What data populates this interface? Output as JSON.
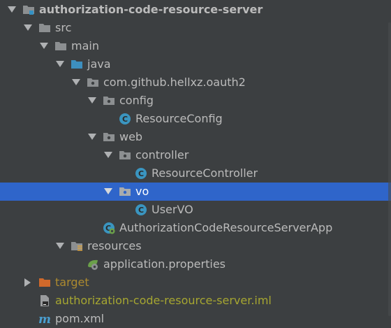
{
  "tree": {
    "nodes": [
      {
        "label": "authorization-code-resource-server",
        "icon": "module-icon",
        "expanded": true
      },
      {
        "label": "src",
        "icon": "folder-icon",
        "expanded": true
      },
      {
        "label": "main",
        "icon": "folder-icon",
        "expanded": true
      },
      {
        "label": "java",
        "icon": "source-root-icon",
        "expanded": true
      },
      {
        "label": "com.github.hellxz.oauth2",
        "icon": "package-icon",
        "expanded": true
      },
      {
        "label": "config",
        "icon": "package-icon",
        "expanded": true
      },
      {
        "label": "ResourceConfig",
        "icon": "class-icon"
      },
      {
        "label": "web",
        "icon": "package-icon",
        "expanded": true
      },
      {
        "label": "controller",
        "icon": "package-icon",
        "expanded": true
      },
      {
        "label": "ResourceController",
        "icon": "class-icon"
      },
      {
        "label": "vo",
        "icon": "package-icon",
        "expanded": true,
        "selected": true
      },
      {
        "label": "UserVO",
        "icon": "class-icon"
      },
      {
        "label": "AuthorizationCodeResourceServerApp",
        "icon": "spring-boot-app-icon"
      },
      {
        "label": "resources",
        "icon": "resources-root-icon",
        "expanded": true
      },
      {
        "label": "application.properties",
        "icon": "spring-properties-icon"
      },
      {
        "label": "target",
        "icon": "excluded-folder-icon",
        "expanded": false
      },
      {
        "label": "authorization-code-resource-server.iml",
        "icon": "iml-file-icon"
      },
      {
        "label": "pom.xml",
        "icon": "maven-icon"
      }
    ]
  },
  "colors": {
    "background": "#3c3f41",
    "selection": "#2f65ca",
    "text": "#bbbbbb",
    "excluded_text": "#ad8a2f",
    "iml_text": "#a6a631"
  }
}
